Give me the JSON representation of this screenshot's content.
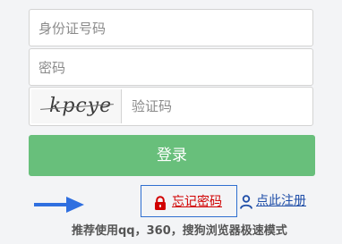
{
  "form": {
    "idcard_placeholder": "身份证号码",
    "password_placeholder": "密码",
    "captcha_code": "kpcye",
    "captcha_placeholder": "验证码"
  },
  "buttons": {
    "login_label": "登录"
  },
  "links": {
    "forgot_label": "忘记密码",
    "register_label": "点此注册"
  },
  "tip": "推荐使用qq，360，搜狗浏览器极速模式",
  "icons": {
    "arrow": "arrow-right-icon",
    "forgot": "lock-icon",
    "register": "user-icon"
  },
  "colors": {
    "login_button": "#68bf7b",
    "forgot_text": "#d10000",
    "forgot_border": "#2f6fd0",
    "register_text": "#1f4ea8",
    "arrow": "#2f6fe0"
  }
}
